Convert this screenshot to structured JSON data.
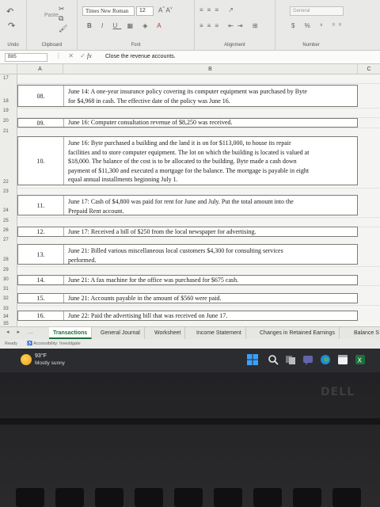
{
  "ribbon": {
    "font_name": "Times New Roman",
    "font_size": "12",
    "number_format": "General",
    "groups": {
      "undo": "Undo",
      "clipboard": "Clipboard",
      "font": "Font",
      "alignment": "Alignment",
      "number": "Number"
    },
    "paste_label": "Paste"
  },
  "formula_bar": {
    "cell_ref": "B85",
    "fx": "fx",
    "content": "Close the revenue accounts."
  },
  "columns": [
    "A",
    "B",
    "C"
  ],
  "rows": [
    "17",
    "18",
    "19",
    "20",
    "21",
    "22",
    "23",
    "24",
    "25",
    "26",
    "27",
    "28",
    "29",
    "30",
    "31",
    "32",
    "33",
    "34",
    "35"
  ],
  "entries": [
    {
      "num": "08.",
      "lines": [
        "June 14: A one-year insurance policy covering its computer equipment was purchased by Byte",
        "for $4,968 in cash.  The effective date of the policy was June 16."
      ]
    },
    {
      "num": "09.",
      "lines": [
        "June 16:  Computer consultation revenue of $8,250 was received."
      ]
    },
    {
      "num": "10.",
      "lines": [
        "June 16:  Byte purchased a building and the land it is on for $113,000, to house its repair",
        "facilities and to store computer equipment.  The lot on which the building is located is valued at",
        "$18,000. The balance of the cost is to be allocated to the building.  Byte made a cash down",
        "payment of $11,300  and executed a mortgage for the balance.  The mortgage is payable in eight",
        "equal annual installments beginning July 1."
      ]
    },
    {
      "num": "11.",
      "lines": [
        "June 17:  Cash of $4,800 was paid for rent for June and July.  Put the total amount into the",
        "Prepaid Rent account."
      ]
    },
    {
      "num": "12.",
      "lines": [
        "June 17:  Received a bill of $250 from the local newspaper for advertising."
      ]
    },
    {
      "num": "13.",
      "lines": [
        "June 21: Billed various miscellaneous local customers $4,300 for consulting services",
        "performed."
      ]
    },
    {
      "num": "14.",
      "lines": [
        "June 21:  A fax machine for the office was purchased for $675 cash."
      ]
    },
    {
      "num": "15.",
      "lines": [
        "June 21:  Accounts payable in the amount of $560 were paid."
      ]
    },
    {
      "num": "16.",
      "lines": [
        "June 22:  Paid the advertising bill that was received on June 17."
      ]
    }
  ],
  "sheet_tabs": [
    "Transactions",
    "General Journal",
    "Worksheet",
    "Income Statement",
    "Changes in Retained Earnings",
    "Balance S"
  ],
  "status": {
    "ready": "Ready",
    "accessibility": "Accessibility: Investigate"
  },
  "taskbar": {
    "temperature": "93°F",
    "weather": "Mostly sunny"
  },
  "colors": {
    "accent": "#1d6f3c",
    "taskbar": "#2a2c30"
  }
}
